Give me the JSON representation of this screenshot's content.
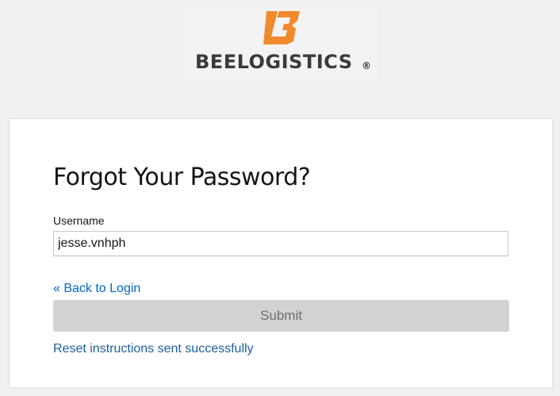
{
  "brand": {
    "logo_text": "BEELOGISTICS",
    "registered_mark": "®",
    "logo_color": "#f08a2c"
  },
  "form": {
    "title": "Forgot Your Password?",
    "username_label": "Username",
    "username_value": "jesse.vnhph",
    "back_link": "« Back to Login",
    "submit_label": "Submit",
    "status_message": "Reset instructions sent successfully"
  },
  "colors": {
    "link": "#0066cc",
    "button_disabled_bg": "#d2d2d2",
    "button_disabled_text": "#6a6e73",
    "page_bg": "#f0f0f0"
  }
}
